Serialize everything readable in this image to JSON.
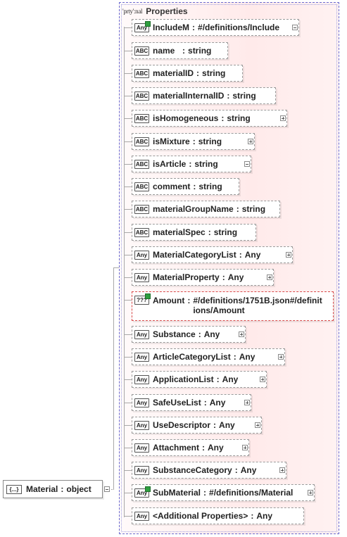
{
  "group": {
    "tag": "'prty':nal",
    "label": "Properties"
  },
  "root": {
    "badge": "{...}",
    "name": "Material",
    "type": "object"
  },
  "properties": [
    {
      "badge": "Any",
      "ref": true,
      "name": "IncludeM",
      "type": "#/definitions/Include",
      "expander": "minus"
    },
    {
      "badge": "ABC",
      "name": "name  ",
      "type": "string"
    },
    {
      "badge": "ABC",
      "name": "materialID",
      "type": "string"
    },
    {
      "badge": "ABC",
      "name": "materialInternalID",
      "type": "string"
    },
    {
      "badge": "ABC",
      "name": "isHomogeneous",
      "type": "string",
      "expander": "plus"
    },
    {
      "badge": "ABC",
      "name": "isMixture",
      "type": "string",
      "expander": "plus"
    },
    {
      "badge": "ABC",
      "name": "isArticle",
      "type": "string",
      "expander": "minus"
    },
    {
      "badge": "ABC",
      "name": "comment",
      "type": "string"
    },
    {
      "badge": "ABC",
      "name": "materialGroupName",
      "type": "string"
    },
    {
      "badge": "ABC",
      "name": "materialSpec",
      "type": "string"
    },
    {
      "badge": "Any",
      "name": "MaterialCategoryList",
      "type": "Any",
      "expander": "plus"
    },
    {
      "badge": "Any",
      "name": "MaterialProperty",
      "type": "Any",
      "expander": "plus"
    },
    {
      "badge": "???",
      "ref": true,
      "error": true,
      "name": "Amount",
      "type": "#/definitions/1751B.json#/definitions/Amount"
    },
    {
      "badge": "Any",
      "name": "Substance",
      "type": "Any",
      "expander": "plus"
    },
    {
      "badge": "Any",
      "name": "ArticleCategoryList",
      "type": "Any",
      "expander": "plus"
    },
    {
      "badge": "Any",
      "name": "ApplicationList",
      "type": "Any",
      "expander": "plus"
    },
    {
      "badge": "Any",
      "name": "SafeUseList",
      "type": "Any",
      "expander": "plus"
    },
    {
      "badge": "Any",
      "name": "UseDescriptor",
      "type": "Any",
      "expander": "plus"
    },
    {
      "badge": "Any",
      "name": "Attachment",
      "type": "Any",
      "expander": "plus"
    },
    {
      "badge": "Any",
      "name": "SubstanceCategory",
      "type": "Any",
      "expander": "plus"
    },
    {
      "badge": "Any",
      "ref": true,
      "name": "SubMaterial",
      "type": "#/definitions/Material",
      "expander": "plus"
    },
    {
      "badge": "Any",
      "name": "<Additional Properties>",
      "type": "Any"
    }
  ]
}
